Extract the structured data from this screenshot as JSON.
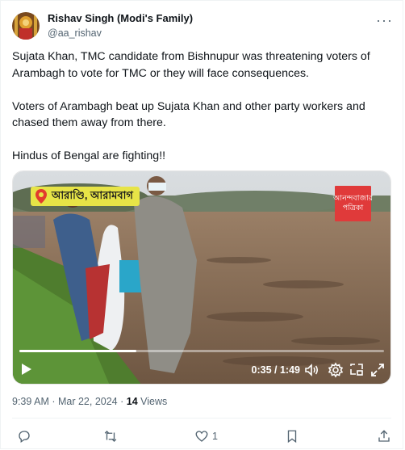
{
  "author": {
    "name": "Rishav Singh (Modi's Family)",
    "handle": "@aa_rishav"
  },
  "post": {
    "paragraphs": [
      "Sujata Khan, TMC candidate from Bishnupur was threatening voters of Arambagh to vote for TMC or they will face consequences.",
      "Voters of Arambagh beat up Sujata Khan and other party workers and chased them away from there.",
      "Hindus of Bengal are fighting!!"
    ]
  },
  "video": {
    "location_tag": "আরাণ্ডি, আরামবাগ",
    "brand_line1": "আনন্দবাজার",
    "brand_line2": "পত্রিকা",
    "time_display": "0:35 / 1:49",
    "progress_fraction": 0.32
  },
  "meta": {
    "timestamp": "9:39 AM · Mar 22, 2024 · ",
    "views_count": "14",
    "views_label": " Views"
  },
  "actions": {
    "like_count": "1"
  },
  "colors": {
    "text_primary": "#0f1419",
    "text_secondary": "#536471",
    "divider": "#eff3f4",
    "tag_yellow": "#e7e447",
    "brand_red": "#e03a3a"
  },
  "icons": [
    "more-icon",
    "play-icon",
    "volume-icon",
    "settings-icon",
    "pip-icon",
    "fullscreen-icon",
    "reply-icon",
    "retweet-icon",
    "like-icon",
    "bookmark-icon",
    "share-icon"
  ]
}
